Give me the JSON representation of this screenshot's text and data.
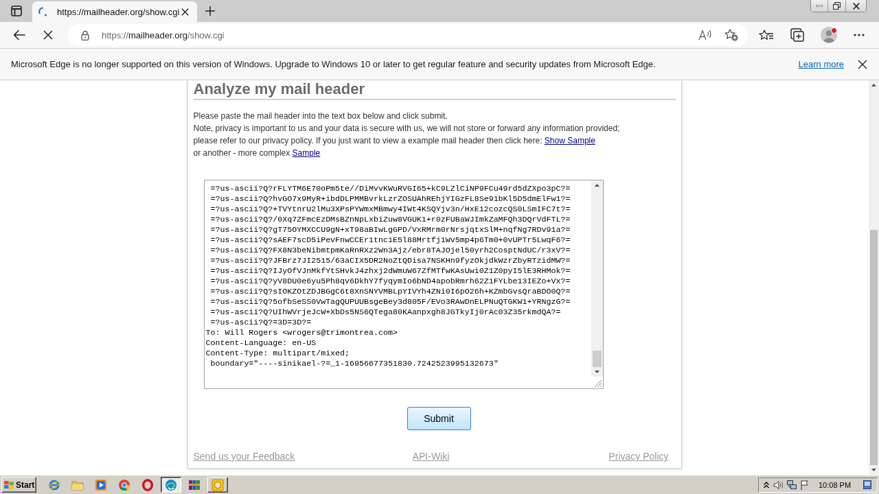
{
  "browser": {
    "loading": true,
    "tabs": [
      {
        "title": "https://mailheader.org/show.cgi",
        "selected": true
      }
    ],
    "address": {
      "url": [
        "https://",
        "mailheader.org",
        "/show.cgi"
      ]
    }
  },
  "infobar": {
    "message": "Microsoft Edge is no longer supported on this version of Windows. Upgrade to Windows 10 or later to get regular feature and security updates from Microsoft Edge.",
    "link": "Learn more"
  },
  "page": {
    "heading": "Analyze my mail header",
    "intro": [
      {
        "text": "Please paste the mail header into the text box below and click submit."
      },
      {
        "text": "Note, privacy is important to us and your data is secure with us, we will not store or forward any information provided;"
      },
      {
        "text": "please refer to our privacy policy. If you just want to view a example mail header then click here: ",
        "link": "Show Sample"
      },
      {
        "text": "or another - more complex ",
        "link": "Sample"
      }
    ],
    "header_field": {
      "value": " =?us-ascii?Q?rFLYTM6E70oPm5te//DiMvvKWuRVGI65+kC9LZlCiNP9FCu49rd5dZXpo3pC?=\n =?us-ascii?Q?hvGO7x9MyR+ibdDLPMMBvrkLzrZOSUAhREhjYIGzFL8Se91bKl5D5dmElFw1?=\n =?us-ascii?Q?+TVYtnrU2lMu3XPsPYWmxMBmwy4IWt4KSQYjv3n/HxE12cozcQS0LSmIFC7t?=\n =?us-ascii?Q?/0Xq7ZFmcEzDMsBZnNpLxbiZuw8VGUK1+r0zFUBaWJImkZaMFQh3DQrVdFTL?=\n =?us-ascii?Q?gT75OYMXCCU9gN+xT98aBIwLgGPD/VxRMrm0rNrsjqtxSlM+nqfNg7RDv91a?=\n =?us-ascii?Q?sAEF7scD5iPevFnwCCEr1tnc1E5l88Mrtfj1Wv5mp4p6Tm0+0vUPTr5LwqF6?=\n =?us-ascii?Q?FX8N3beNibmtpmKaRnRXz2Wn3Ajz/ebr8TAJOjel50yrh2CosptNdUC/r3xV?=\n =?us-ascii?Q?JFBrz7JI2515/63aCIX5DR2NoZtQDisa7NSKHn9fyzOkjdkWzrZbyRTzidMW?=\n =?us-ascii?Q?IJyOfVJnMkfYtSHvkJ4zhxj2dWmuW67ZfMTfwKAsUwi0Z1Z0pyI5lE3RHMok?=\n =?us-ascii?Q?yV8DU0e6yu5Ph8qv6DkhY7fyqymIo6bND4apobRmrh62Z1FYLbe13IEZo+Vx?=\n =?us-ascii?Q?sIOKZOtZDJBGgC6t8XnSNYVMBLpYIVYh4ZNi0I6pO26h+KZmbGvsQraBDO0Q?=\n =?us-ascii?Q?5ofbSeSS0VwTagQUPUUBsgeBey3d805F/EVo3RAwDnELPNuQTGKW1+YRNgzG?=\n =?us-ascii?Q?UIhWVrjeJcW+XbDs5NS6QTega80KAanpxgh8JGTkyIj0rAc03Z35rkmdQA?=\n =?us-ascii?Q?=3D=3D?=\nTo: Will Rogers <wrogers@trimontrea.com>\nContent-Language: en-US\nContent-Type: multipart/mixed;\n boundary=\"----sinikael-?=_1-16956677351830.7242523995132673\""
    },
    "submit": "Submit",
    "footer_links": [
      "Send us your Feedback",
      "API-Wiki",
      "Privacy Policy"
    ]
  },
  "taskbar": {
    "start": "Start",
    "apps": [
      {
        "kind": "globe",
        "open": false,
        "selected": false
      },
      {
        "kind": "folder",
        "open": false,
        "selected": false
      },
      {
        "kind": "player",
        "open": false,
        "selected": false
      },
      {
        "kind": "wheel",
        "open": false,
        "selected": false
      },
      {
        "kind": "ring",
        "open": false,
        "selected": false
      },
      {
        "kind": "swirl",
        "open": true,
        "selected": true
      },
      {
        "kind": "books",
        "open": false,
        "selected": false
      },
      {
        "kind": "tile",
        "open": true,
        "selected": false
      }
    ],
    "clock": "10:08 PM"
  }
}
